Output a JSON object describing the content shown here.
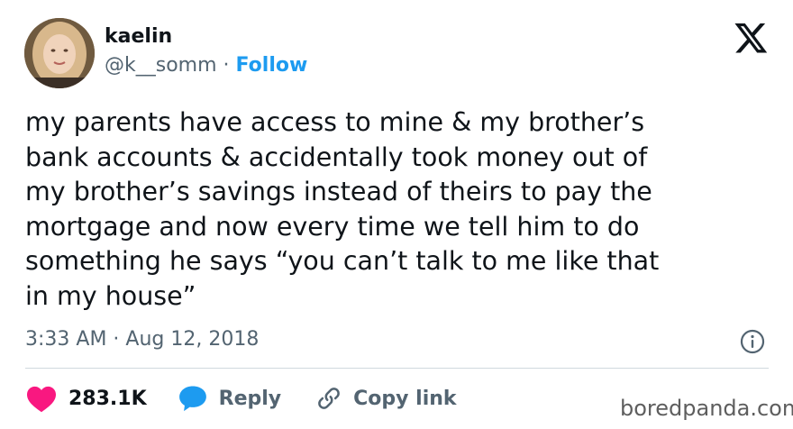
{
  "author": {
    "display_name": "kaelin",
    "handle": "@k__somm",
    "separator": "·",
    "follow_label": "Follow"
  },
  "tweet": {
    "text": "my parents have access to mine & my brother’s\nbank accounts & accidentally took money out of\nmy brother’s savings instead of theirs to pay the\nmortgage and now every time we tell him to do\nsomething he says “you can’t talk to me like that\nin my house”",
    "timestamp": "3:33 AM · Aug 12, 2018"
  },
  "actions": {
    "like_count": "283.1K",
    "reply_label": "Reply",
    "copy_link_label": "Copy link"
  },
  "watermark": "boredpanda.com",
  "icons": {
    "brand": "x-logo-icon",
    "like": "heart-icon",
    "reply": "speech-bubble-icon",
    "copy": "link-icon",
    "info": "info-icon"
  },
  "colors": {
    "like": "#f91880",
    "reply": "#1d9bf0",
    "follow": "#1d9bf0",
    "text": "#0f1419",
    "muted": "#536471"
  }
}
